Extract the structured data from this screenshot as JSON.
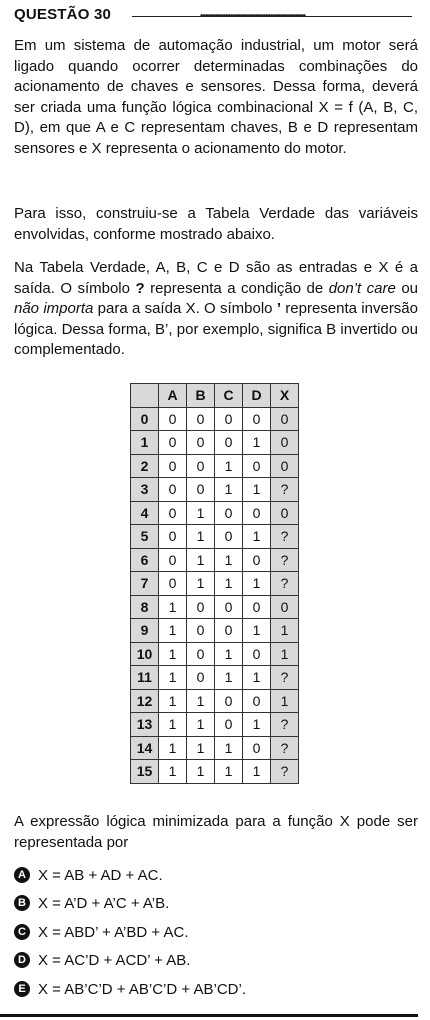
{
  "question": {
    "title": "QUESTÃO 30",
    "paragraph1": "Em um sistema de automação industrial, um motor será ligado quando ocorrer determinadas combinações do acionamento de chaves e sensores. Dessa forma, deverá ser criada uma função lógica combinacional X = f (A, B, C, D), em que A e C representam chaves, B e D representam sensores e X representa o acionamento do motor.",
    "paragraph2": "Para isso, construiu-se a Tabela Verdade das variáveis envolvidas, conforme mostrado abaixo.",
    "paragraph3_a": "Na Tabela Verdade, A, B, C e D são as entradas e X é a saída. O símbolo ",
    "symbol_q": "?",
    "paragraph3_b": " representa a condição de ",
    "dont_care": "don’t care",
    "paragraph3_c": " ou ",
    "nao_importa": "não importa",
    "paragraph3_d": " para a saída X. O símbolo ",
    "symbol_prime": "’",
    "paragraph3_e": " representa inversão lógica. Dessa forma, B’, por exemplo, significa B invertido ou complementado.",
    "paragraph4": "A expressão lógica minimizada para a função X pode ser representada por"
  },
  "truth_table": {
    "headers": [
      "A",
      "B",
      "C",
      "D",
      "X"
    ],
    "rows": [
      {
        "index": "0",
        "A": "0",
        "B": "0",
        "C": "0",
        "D": "0",
        "X": "0"
      },
      {
        "index": "1",
        "A": "0",
        "B": "0",
        "C": "0",
        "D": "1",
        "X": "0"
      },
      {
        "index": "2",
        "A": "0",
        "B": "0",
        "C": "1",
        "D": "0",
        "X": "0"
      },
      {
        "index": "3",
        "A": "0",
        "B": "0",
        "C": "1",
        "D": "1",
        "X": "?"
      },
      {
        "index": "4",
        "A": "0",
        "B": "1",
        "C": "0",
        "D": "0",
        "X": "0"
      },
      {
        "index": "5",
        "A": "0",
        "B": "1",
        "C": "0",
        "D": "1",
        "X": "?"
      },
      {
        "index": "6",
        "A": "0",
        "B": "1",
        "C": "1",
        "D": "0",
        "X": "?"
      },
      {
        "index": "7",
        "A": "0",
        "B": "1",
        "C": "1",
        "D": "1",
        "X": "?"
      },
      {
        "index": "8",
        "A": "1",
        "B": "0",
        "C": "0",
        "D": "0",
        "X": "0"
      },
      {
        "index": "9",
        "A": "1",
        "B": "0",
        "C": "0",
        "D": "1",
        "X": "1"
      },
      {
        "index": "10",
        "A": "1",
        "B": "0",
        "C": "1",
        "D": "0",
        "X": "1"
      },
      {
        "index": "11",
        "A": "1",
        "B": "0",
        "C": "1",
        "D": "1",
        "X": "?"
      },
      {
        "index": "12",
        "A": "1",
        "B": "1",
        "C": "0",
        "D": "0",
        "X": "1"
      },
      {
        "index": "13",
        "A": "1",
        "B": "1",
        "C": "0",
        "D": "1",
        "X": "?"
      },
      {
        "index": "14",
        "A": "1",
        "B": "1",
        "C": "1",
        "D": "0",
        "X": "?"
      },
      {
        "index": "15",
        "A": "1",
        "B": "1",
        "C": "1",
        "D": "1",
        "X": "?"
      }
    ]
  },
  "options": [
    {
      "letter": "A",
      "text": "X = AB + AD + AC."
    },
    {
      "letter": "B",
      "text": "X = A’D + A’C + A’B."
    },
    {
      "letter": "C",
      "text": "X = ABD’ + A’BD + AC."
    },
    {
      "letter": "D",
      "text": "X = AC’D + ACD’ + AB."
    },
    {
      "letter": "E",
      "text": "X = AB’C’D + AB’C’D + AB’CD’."
    }
  ]
}
